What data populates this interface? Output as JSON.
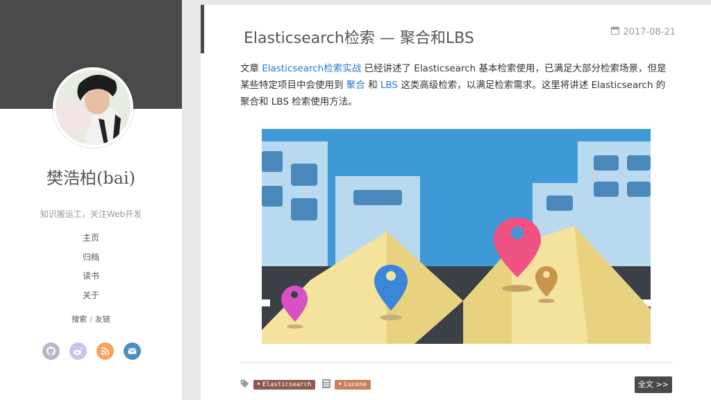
{
  "sidebar": {
    "author": "樊浩柏(bai)",
    "tagline": "知识搬运工，关注Web开发",
    "nav": [
      "主页",
      "归档",
      "读书",
      "关于"
    ],
    "search_label": "搜索",
    "separator": "/",
    "links_label": "友链",
    "social": [
      {
        "icon": "github-icon",
        "color": "#b7b7c8"
      },
      {
        "icon": "weibo-icon",
        "color": "#c4c4ef"
      },
      {
        "icon": "rss-icon",
        "color": "#f7a35c"
      },
      {
        "icon": "mail-icon",
        "color": "#4d8fc0"
      }
    ]
  },
  "post": {
    "title": "Elasticsearch检索 — 聚合和LBS",
    "date": "2017-08-21",
    "excerpt": {
      "part1": "文章 ",
      "link1": "Elasticsearch检索实战",
      "part2": " 已经讲述了 Elasticsearch 基本检索使用，已满足大部分检索场景，但是某些特定项目中会使用到 ",
      "link2": "聚合",
      "part3": " 和 ",
      "link3": "LBS",
      "part4": " 这类高级检索，以满足检索需求。这里将讲述 Elasticsearch 的聚合和 LBS 检索使用方法。"
    },
    "tags": [
      "Elasticsearch",
      "Lucene"
    ],
    "more_label": "全文 >>"
  },
  "colors": {
    "accent": "#2479cc",
    "dark": "#4a4a4a",
    "tag1": "#8e5a4e",
    "tag2": "#c97f5a"
  }
}
